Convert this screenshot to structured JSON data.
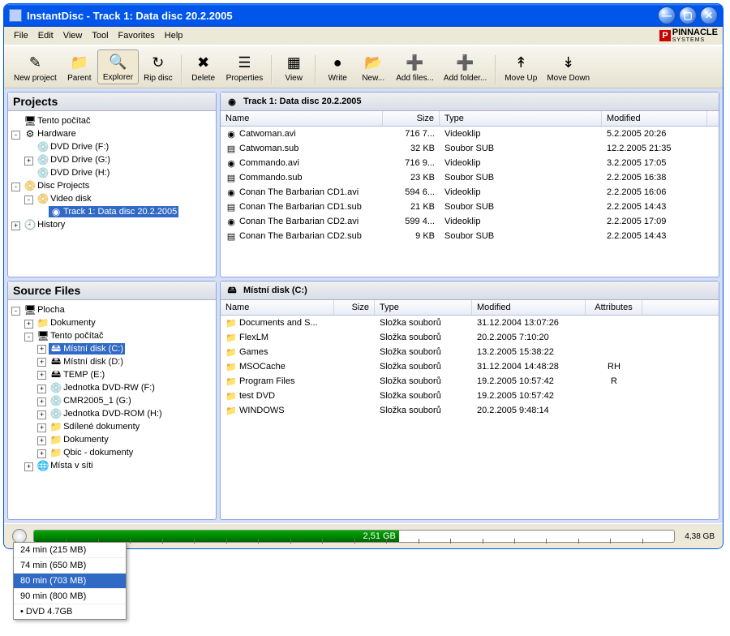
{
  "title": "InstantDisc   - Track 1: Data disc 20.2.2005",
  "menu": [
    "File",
    "Edit",
    "View",
    "Tool",
    "Favorites",
    "Help"
  ],
  "logo": {
    "prefix": "P",
    "text": "PINNACLE",
    "sub": "SYSTEMS"
  },
  "toolbar": [
    {
      "label": "New project",
      "icon": "✎"
    },
    {
      "label": "Parent",
      "icon": "📁"
    },
    {
      "label": "Explorer",
      "icon": "🔍",
      "active": true
    },
    {
      "label": "Rip disc",
      "icon": "↻"
    },
    {
      "sep": true
    },
    {
      "label": "Delete",
      "icon": "✖"
    },
    {
      "label": "Properties",
      "icon": "☰"
    },
    {
      "sep": true
    },
    {
      "label": "View",
      "icon": "▦"
    },
    {
      "sep": true
    },
    {
      "label": "Write",
      "icon": "●"
    },
    {
      "label": "New...",
      "icon": "📂"
    },
    {
      "label": "Add files...",
      "icon": "➕"
    },
    {
      "label": "Add folder...",
      "icon": "➕"
    },
    {
      "sep": true
    },
    {
      "label": "Move Up",
      "icon": "↟"
    },
    {
      "label": "Move Down",
      "icon": "↡"
    }
  ],
  "projects": {
    "header": "Projects",
    "tree": [
      {
        "exp": "",
        "icon": "🖥",
        "label": "Tento počítač"
      },
      {
        "exp": "-",
        "icon": "⚙",
        "label": "Hardware",
        "indent": 0
      },
      {
        "exp": "",
        "icon": "💿",
        "label": "DVD Drive (F:)",
        "indent": 1
      },
      {
        "exp": "+",
        "icon": "💿",
        "label": "DVD Drive (G:)",
        "indent": 1
      },
      {
        "exp": "",
        "icon": "💿",
        "label": "DVD Drive (H:)",
        "indent": 1
      },
      {
        "exp": "-",
        "icon": "📀",
        "label": "Disc Projects",
        "indent": 0
      },
      {
        "exp": "-",
        "icon": "📀",
        "label": "Video disk",
        "indent": 1
      },
      {
        "exp": "",
        "icon": "◉",
        "label": "Track 1: Data disc 20.2.2005",
        "indent": 2,
        "selected": true
      },
      {
        "exp": "+",
        "icon": "🕘",
        "label": "History",
        "indent": 0
      }
    ]
  },
  "trackPanel": {
    "header": "Track 1: Data disc 20.2.2005",
    "cols": [
      "Name",
      "Size",
      "Type",
      "Modified"
    ],
    "rows": [
      {
        "icon": "◉",
        "name": "Catwoman.avi",
        "size": "716 7...",
        "type": "Videoklip",
        "mod": "5.2.2005 20:26"
      },
      {
        "icon": "▤",
        "name": "Catwoman.sub",
        "size": "32 KB",
        "type": "Soubor SUB",
        "mod": "12.2.2005 21:35"
      },
      {
        "icon": "◉",
        "name": "Commando.avi",
        "size": "716 9...",
        "type": "Videoklip",
        "mod": "3.2.2005 17:05"
      },
      {
        "icon": "▤",
        "name": "Commando.sub",
        "size": "23 KB",
        "type": "Soubor SUB",
        "mod": "2.2.2005 16:38"
      },
      {
        "icon": "◉",
        "name": "Conan The Barbarian CD1.avi",
        "size": "594 6...",
        "type": "Videoklip",
        "mod": "2.2.2005 16:06"
      },
      {
        "icon": "▤",
        "name": "Conan The Barbarian CD1.sub",
        "size": "21 KB",
        "type": "Soubor SUB",
        "mod": "2.2.2005 14:43"
      },
      {
        "icon": "◉",
        "name": "Conan The Barbarian CD2.avi",
        "size": "599 4...",
        "type": "Videoklip",
        "mod": "2.2.2005 17:09"
      },
      {
        "icon": "▤",
        "name": "Conan The Barbarian CD2.sub",
        "size": "9 KB",
        "type": "Soubor SUB",
        "mod": "2.2.2005 14:43"
      }
    ]
  },
  "source": {
    "header": "Source Files",
    "tree": [
      {
        "exp": "-",
        "icon": "🖥",
        "label": "Plocha"
      },
      {
        "exp": "+",
        "icon": "📁",
        "label": "Dokumenty",
        "indent": 1
      },
      {
        "exp": "-",
        "icon": "🖥",
        "label": "Tento počítač",
        "indent": 1
      },
      {
        "exp": "+",
        "icon": "🖴",
        "label": "Místní disk (C:)",
        "indent": 2,
        "selected": true
      },
      {
        "exp": "+",
        "icon": "🖴",
        "label": "Místní disk (D:)",
        "indent": 2
      },
      {
        "exp": "+",
        "icon": "🖴",
        "label": "TEMP (E:)",
        "indent": 2
      },
      {
        "exp": "+",
        "icon": "💿",
        "label": "Jednotka DVD-RW (F:)",
        "indent": 2
      },
      {
        "exp": "+",
        "icon": "💿",
        "label": "CMR2005_1 (G:)",
        "indent": 2
      },
      {
        "exp": "+",
        "icon": "💿",
        "label": "Jednotka DVD-ROM (H:)",
        "indent": 2
      },
      {
        "exp": "+",
        "icon": "📁",
        "label": "Sdílené dokumenty",
        "indent": 2
      },
      {
        "exp": "+",
        "icon": "📁",
        "label": "Dokumenty",
        "indent": 2
      },
      {
        "exp": "+",
        "icon": "📁",
        "label": "Qbic - dokumenty",
        "indent": 2
      },
      {
        "exp": "+",
        "icon": "🌐",
        "label": "Místa v síti",
        "indent": 1
      }
    ]
  },
  "drivePanel": {
    "header": "Místní disk (C:)",
    "cols": [
      "Name",
      "Size",
      "Type",
      "Modified",
      "Attributes"
    ],
    "rows": [
      {
        "icon": "📁",
        "name": "Documents and S...",
        "size": "",
        "type": "Složka souborů",
        "mod": "31.12.2004 13:07:26",
        "attr": ""
      },
      {
        "icon": "📁",
        "name": "FlexLM",
        "size": "",
        "type": "Složka souborů",
        "mod": "20.2.2005 7:10:20",
        "attr": ""
      },
      {
        "icon": "📁",
        "name": "Games",
        "size": "",
        "type": "Složka souborů",
        "mod": "13.2.2005 15:38:22",
        "attr": ""
      },
      {
        "icon": "📁",
        "name": "MSOCache",
        "size": "",
        "type": "Složka souborů",
        "mod": "31.12.2004 14:48:28",
        "attr": "RH"
      },
      {
        "icon": "📁",
        "name": "Program Files",
        "size": "",
        "type": "Složka souborů",
        "mod": "19.2.2005 10:57:42",
        "attr": "R"
      },
      {
        "icon": "📁",
        "name": "test DVD",
        "size": "",
        "type": "Složka souborů",
        "mod": "19.2.2005 10:57:42",
        "attr": ""
      },
      {
        "icon": "📁",
        "name": "WINDOWS",
        "size": "",
        "type": "Složka souborů",
        "mod": "20.2.2005 9:48:14",
        "attr": ""
      }
    ]
  },
  "capacity": {
    "used": "2,51 GB",
    "max": "4,38 GB",
    "filledPct": 57
  },
  "popup": [
    {
      "label": "24 min (215 MB)"
    },
    {
      "label": "74 min (650 MB)"
    },
    {
      "label": "80 min (703 MB)",
      "selected": true
    },
    {
      "label": "90 min (800 MB)"
    },
    {
      "label": "DVD 4.7GB",
      "bullet": true
    }
  ]
}
